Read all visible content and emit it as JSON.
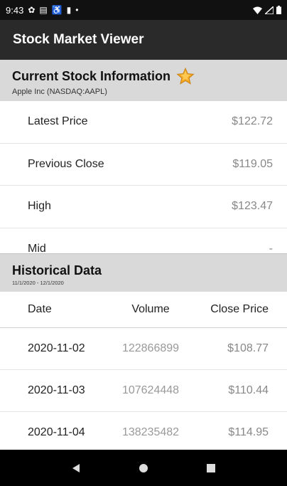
{
  "status_bar": {
    "time": "9:43",
    "icons_left": [
      "settings-icon",
      "message-icon",
      "accessibility-icon",
      "sd-card-icon",
      "dot-icon"
    ],
    "icons_right": [
      "wifi-icon",
      "signal-icon",
      "battery-icon"
    ]
  },
  "app_bar": {
    "title": "Stock Market Viewer"
  },
  "current": {
    "title": "Current Stock Information",
    "subtitle": "Apple Inc (NASDAQ:AAPL)",
    "favorite_icon": "star-icon",
    "rows": [
      {
        "label": "Latest Price",
        "value": "$122.72"
      },
      {
        "label": "Previous Close",
        "value": "$119.05"
      },
      {
        "label": "High",
        "value": "$123.47"
      },
      {
        "label": "Mid",
        "value": "-"
      }
    ]
  },
  "historical": {
    "title": "Historical Data",
    "subtitle": "11/1/2020 - 12/1/2020",
    "headers": {
      "date": "Date",
      "volume": "Volume",
      "close": "Close Price"
    },
    "rows": [
      {
        "date": "2020-11-02",
        "volume": "122866899",
        "close": "$108.77"
      },
      {
        "date": "2020-11-03",
        "volume": "107624448",
        "close": "$110.44"
      },
      {
        "date": "2020-11-04",
        "volume": "138235482",
        "close": "$114.95"
      }
    ]
  },
  "nav": {
    "back": "back-icon",
    "home": "home-icon",
    "recents": "recents-icon"
  },
  "colors": {
    "app_bar": "#2a2a2a",
    "section_header": "#d9d9d9",
    "star": "#f5a623"
  }
}
